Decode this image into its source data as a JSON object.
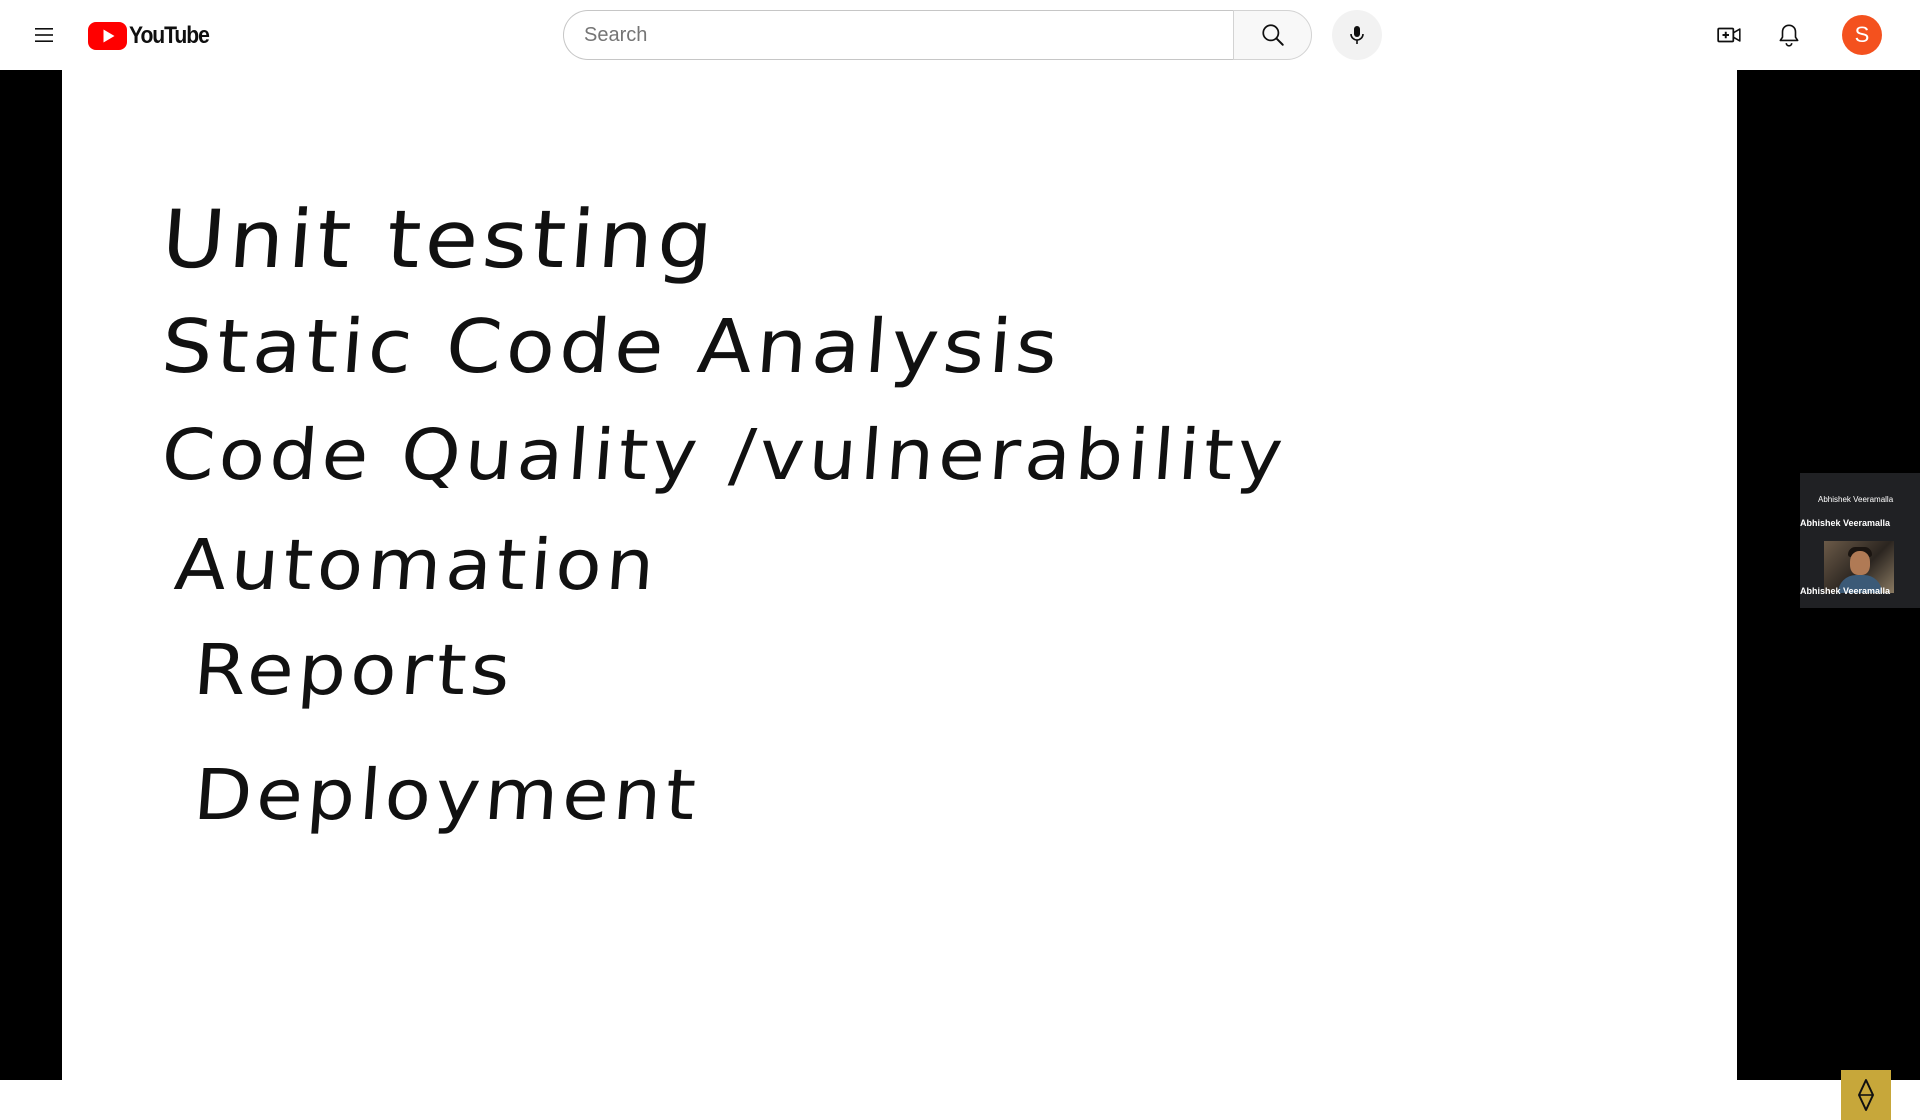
{
  "header": {
    "menu_icon": "hamburger-menu-icon",
    "logo_text": "YouTube",
    "search": {
      "placeholder": "Search",
      "value": ""
    },
    "search_icon": "search-icon",
    "mic_icon": "microphone-icon",
    "create_icon": "create-video-icon",
    "notifications_icon": "bell-icon",
    "avatar_initial": "S"
  },
  "video": {
    "whiteboard_lines": [
      "Unit testing",
      "Static Code Analysis",
      "Code Quality /vulnerability",
      "Automation",
      "Reports",
      "Deployment"
    ],
    "webcam": {
      "name_top": "Abhishek Veeramalla",
      "name_mid": "Abhishek Veeramalla",
      "name_bottom": "Abhishek Veeramalla"
    },
    "badge_icon": "channel-watermark-icon"
  },
  "colors": {
    "brand_red": "#ff0000",
    "avatar_bg": "#f4511e",
    "badge_bg": "#c7a73a",
    "letterbox": "#000000"
  }
}
